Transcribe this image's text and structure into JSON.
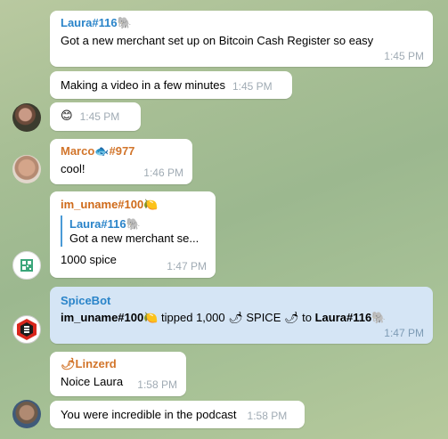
{
  "colors": {
    "laura": "#2a84c9",
    "marco": "#d2752b",
    "im_uname": "#cf6a19",
    "spicebot": "#2a84c9",
    "linzerd": "#d2752b",
    "timestamp": "#a0abb4",
    "bot_bubble": "#d5e5f5"
  },
  "messages": [
    {
      "sender": "Laura#116",
      "sender_emoji": "🐘",
      "text": "Got a new merchant set up on Bitcoin Cash Register so easy",
      "time": "1:45 PM"
    },
    {
      "text": "Making a video in a few minutes",
      "time": "1:45 PM"
    },
    {
      "text": "😊",
      "time": "1:45 PM",
      "avatar": "laura-avatar"
    },
    {
      "sender_pre": "Marco",
      "sender_emoji": "🐟",
      "sender_post": "#977",
      "text": "cool!",
      "time": "1:46 PM",
      "avatar": "marco-avatar"
    },
    {
      "sender": "im_uname#100",
      "sender_emoji": "🍋",
      "reply_name": "Laura#116",
      "reply_emoji": "🐘",
      "reply_text": "Got a new merchant se...",
      "text": "1000 spice",
      "time": "1:47 PM",
      "avatar": "qr-avatar"
    },
    {
      "sender": "SpiceBot",
      "user_a": "im_uname#100",
      "emoji_a": "🍋",
      "middle": " tipped 1,000 ",
      "pepper": "🌶",
      "spice": " SPICE ",
      "to": " to ",
      "user_b": "Laura#116",
      "emoji_b": "🐘",
      "time": "1:47 PM",
      "avatar": "spicebot-avatar"
    },
    {
      "sender_emoji": "🌶",
      "sender": "Linzerd",
      "text": "Noice Laura",
      "time": "1:58 PM"
    },
    {
      "text": "You were incredible in the podcast",
      "time": "1:58 PM",
      "avatar": "linzerd-avatar"
    }
  ]
}
